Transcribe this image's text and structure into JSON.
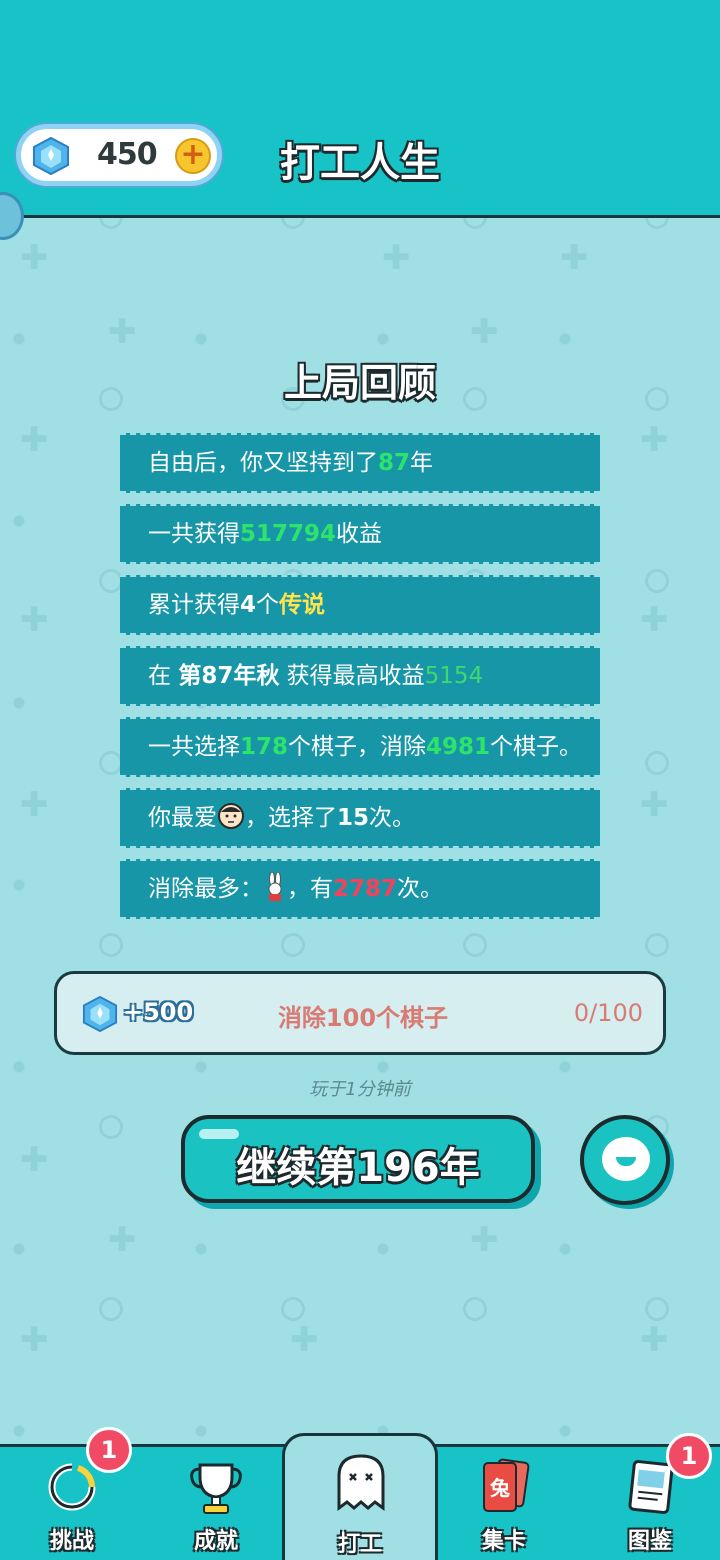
{
  "header": {
    "gem_count": "450",
    "plus_label": "+",
    "title": "打工人生"
  },
  "review": {
    "title": "上局回顾",
    "rows": [
      {
        "pre": "自由后，你又坚持到了",
        "hl": "87",
        "post": "年"
      },
      {
        "pre": "一共获得",
        "hl": "517794",
        "post": "收益"
      },
      {
        "pre": "累计获得",
        "count": "4",
        "mid": "个",
        "hl": "传说"
      },
      {
        "pre": "在 ",
        "bold": "第87年秋",
        "mid": " 获得最高收益",
        "hl": "5154"
      },
      {
        "pre": "一共选择",
        "hl1": "178",
        "mid": "个棋子，消除",
        "hl2": "4981",
        "post": "个棋子。"
      },
      {
        "pre": "你最爱",
        "mid": "，选择了",
        "bold": "15",
        "post": "次。"
      },
      {
        "pre": "消除最多：",
        "mid": "，有",
        "hl": "2787",
        "post": "次。"
      }
    ]
  },
  "quest": {
    "reward": "+500",
    "task": "消除100个棋子",
    "progress": "0/100"
  },
  "played_ago": "玩于1分钟前",
  "continue_label": "继续第196年",
  "nav": {
    "items": [
      {
        "label": "挑战",
        "badge": "1"
      },
      {
        "label": "成就"
      },
      {
        "label": "打工"
      },
      {
        "label": "集卡",
        "icon_text": "兔"
      },
      {
        "label": "图鉴",
        "badge": "1"
      }
    ]
  }
}
